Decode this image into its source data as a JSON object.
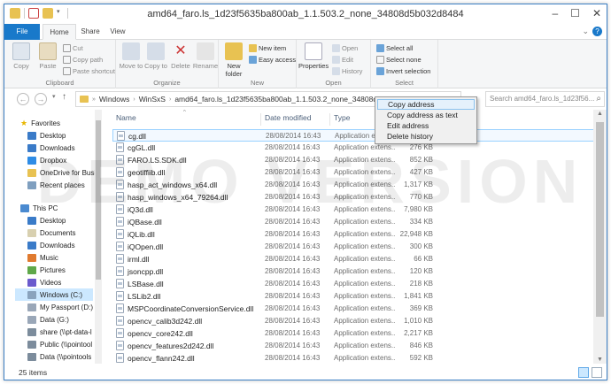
{
  "window": {
    "title": "amd64_faro.ls_1d23f5635ba800ab_1.1.503.2_none_34808d5b032d8484"
  },
  "tabs": [
    "File",
    "Home",
    "Share",
    "View"
  ],
  "ribbon": {
    "clipboard": {
      "label": "Clipboard",
      "copy": "Copy",
      "paste": "Paste",
      "cut": "Cut",
      "copy_path": "Copy path",
      "paste_shortcut": "Paste shortcut"
    },
    "organize": {
      "label": "Organize",
      "move_to": "Move to",
      "copy_to": "Copy to",
      "delete": "Delete",
      "rename": "Rename"
    },
    "new": {
      "label": "New",
      "new_folder": "New folder",
      "new_item": "New item",
      "easy_access": "Easy access"
    },
    "open": {
      "label": "Open",
      "properties": "Properties",
      "open": "Open",
      "edit": "Edit",
      "history": "History"
    },
    "select": {
      "label": "Select",
      "select_all": "Select all",
      "select_none": "Select none",
      "invert_selection": "Invert selection"
    }
  },
  "address": {
    "segments": [
      "Windows",
      "WinSxS",
      "amd64_faro.ls_1d23f5635ba800ab_1.1.503.2_none_34808d5b032d"
    ],
    "search_placeholder": "Search amd64_faro.ls_1d23f56..."
  },
  "nav": {
    "favorites": "Favorites",
    "desktop": "Desktop",
    "downloads": "Downloads",
    "dropbox": "Dropbox",
    "onedrive": "OneDrive for Busi",
    "recent": "Recent places",
    "thispc": "This PC",
    "pc_desktop": "Desktop",
    "documents": "Documents",
    "pc_downloads": "Downloads",
    "music": "Music",
    "pictures": "Pictures",
    "videos": "Videos",
    "windows_c": "Windows (C:)",
    "passport": "My Passport (D:)",
    "data_g": "Data (G:)",
    "share": "share (\\\\pt-data-l",
    "public": "Public (\\\\pointool",
    "data_pointools": "Data (\\\\pointools"
  },
  "columns": {
    "name": "Name",
    "date": "Date modified",
    "type": "Type",
    "size": "Size"
  },
  "files": [
    {
      "name": "cg.dll",
      "date": "28/08/2014 16:43",
      "type": "Application extens...",
      "size": ""
    },
    {
      "name": "cgGL.dll",
      "date": "28/08/2014 16:43",
      "type": "Application extens...",
      "size": "276 KB"
    },
    {
      "name": "FARO.LS.SDK.dll",
      "date": "28/08/2014 16:43",
      "type": "Application extens...",
      "size": "852 KB"
    },
    {
      "name": "geotiffiib.dll",
      "date": "28/08/2014 16:43",
      "type": "Application extens...",
      "size": "427 KB"
    },
    {
      "name": "hasp_act_windows_x64.dll",
      "date": "28/08/2014 16:43",
      "type": "Application extens...",
      "size": "1,317 KB"
    },
    {
      "name": "hasp_windows_x64_79264.dll",
      "date": "28/08/2014 16:43",
      "type": "Application extens...",
      "size": "770 KB"
    },
    {
      "name": "iQ3d.dll",
      "date": "28/08/2014 16:43",
      "type": "Application extens...",
      "size": "7,980 KB"
    },
    {
      "name": "iQBase.dll",
      "date": "28/08/2014 16:43",
      "type": "Application extens...",
      "size": "334 KB"
    },
    {
      "name": "iQLib.dll",
      "date": "28/08/2014 16:43",
      "type": "Application extens...",
      "size": "22,948 KB"
    },
    {
      "name": "iQOpen.dll",
      "date": "28/08/2014 16:43",
      "type": "Application extens...",
      "size": "300 KB"
    },
    {
      "name": "irml.dll",
      "date": "28/08/2014 16:43",
      "type": "Application extens...",
      "size": "66 KB"
    },
    {
      "name": "jsoncpp.dll",
      "date": "28/08/2014 16:43",
      "type": "Application extens...",
      "size": "120 KB"
    },
    {
      "name": "LSBase.dll",
      "date": "28/08/2014 16:43",
      "type": "Application extens...",
      "size": "218 KB"
    },
    {
      "name": "LSLib2.dll",
      "date": "28/08/2014 16:43",
      "type": "Application extens...",
      "size": "1,841 KB"
    },
    {
      "name": "MSPCoordinateConversionService.dll",
      "date": "28/08/2014 16:43",
      "type": "Application extens...",
      "size": "369 KB"
    },
    {
      "name": "opencv_calib3d242.dll",
      "date": "28/08/2014 16:43",
      "type": "Application extens...",
      "size": "1,010 KB"
    },
    {
      "name": "opencv_core242.dll",
      "date": "28/08/2014 16:43",
      "type": "Application extens...",
      "size": "2,217 KB"
    },
    {
      "name": "opencv_features2d242.dll",
      "date": "28/08/2014 16:43",
      "type": "Application extens...",
      "size": "846 KB"
    },
    {
      "name": "opencv_flann242.dll",
      "date": "28/08/2014 16:43",
      "type": "Application extens...",
      "size": "592 KB"
    }
  ],
  "watermark": "DEMO VERSION",
  "context_menu": [
    "Copy address",
    "Copy address as text",
    "Edit address",
    "Delete history"
  ],
  "status": {
    "item_count": "25 items"
  },
  "colors": {
    "accent": "#1979ca",
    "selection": "#cce8ff",
    "folder": "#e8c252"
  }
}
